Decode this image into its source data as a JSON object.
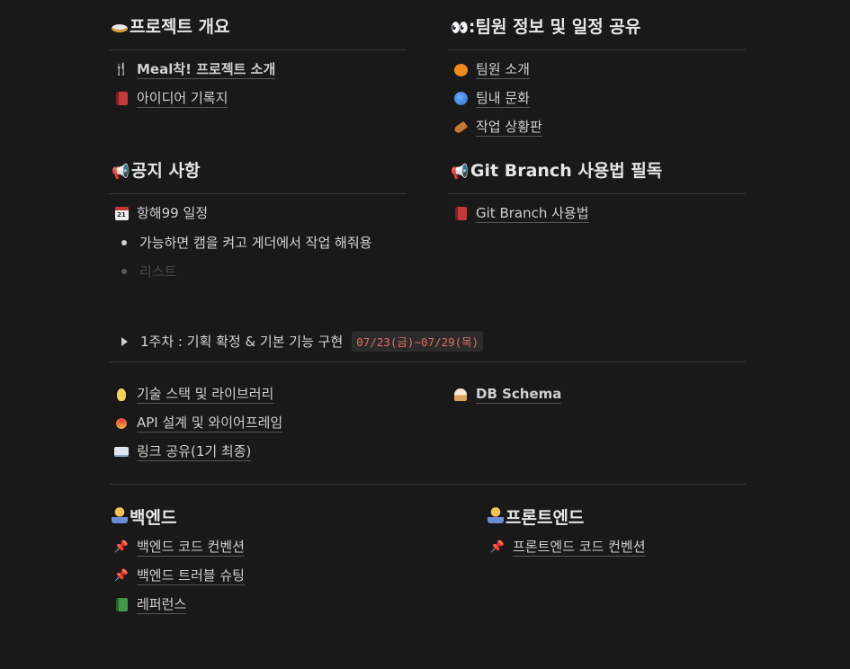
{
  "sections": {
    "overview": {
      "title": "프로젝트 개요",
      "items": [
        {
          "icon": "fork-knife-icon",
          "label": "Meal착! 프로젝트 소개",
          "bold_prefix": "Meal착!"
        },
        {
          "icon": "red-book-icon",
          "label": "아이디어 기록지"
        }
      ]
    },
    "team": {
      "title": ":팀원 정보 및 일정 공유",
      "items": [
        {
          "icon": "pumpkin-icon",
          "label": "팀원 소개"
        },
        {
          "icon": "globe-icon",
          "label": "팀내 문화"
        },
        {
          "icon": "drumstick-icon",
          "label": "작업 상황판"
        }
      ]
    },
    "notice": {
      "title": "공지 사항",
      "items": [
        {
          "icon": "calendar-icon",
          "label": "항해99 일정",
          "calendar_day": "21"
        }
      ],
      "bullets": [
        "가능하면 캠을 켜고 게더에서 작업 해줘용"
      ],
      "bullet_placeholder": "리스트"
    },
    "git": {
      "title": "Git Branch 사용법 필독",
      "items": [
        {
          "icon": "red-book-icon",
          "label": "Git Branch 사용법"
        }
      ]
    },
    "toggle": {
      "label": "1주차 : 기획 확정 & 기본 기능 구현",
      "code": "07/23(금)~07/29(목)"
    },
    "docs_left": [
      {
        "icon": "light-bulb-icon",
        "label": "기술 스택 및 라이브러리"
      },
      {
        "icon": "lollipop-icon",
        "label": "API 설계 및 와이어프레임"
      },
      {
        "icon": "open-book-icon",
        "label": "링크 공유(1기 최종)"
      }
    ],
    "docs_right": [
      {
        "icon": "cupcake-icon",
        "label": "DB Schema"
      }
    ],
    "backend": {
      "title": "백엔드",
      "items": [
        {
          "icon": "pushpin-icon",
          "label": "백엔드 코드 컨벤션"
        },
        {
          "icon": "pushpin-icon",
          "label": "백엔드 트러블 슈팅"
        },
        {
          "icon": "green-book-icon",
          "label": "레퍼런스"
        }
      ]
    },
    "frontend": {
      "title": "프론트엔드",
      "items": [
        {
          "icon": "pushpin-icon",
          "label": "프론트엔드 코드 컨벤션"
        }
      ]
    }
  },
  "colors": {
    "background": "#191919",
    "text": "#d4d4d4",
    "code_text": "#e06c64",
    "divider": "#3a3a3a"
  }
}
